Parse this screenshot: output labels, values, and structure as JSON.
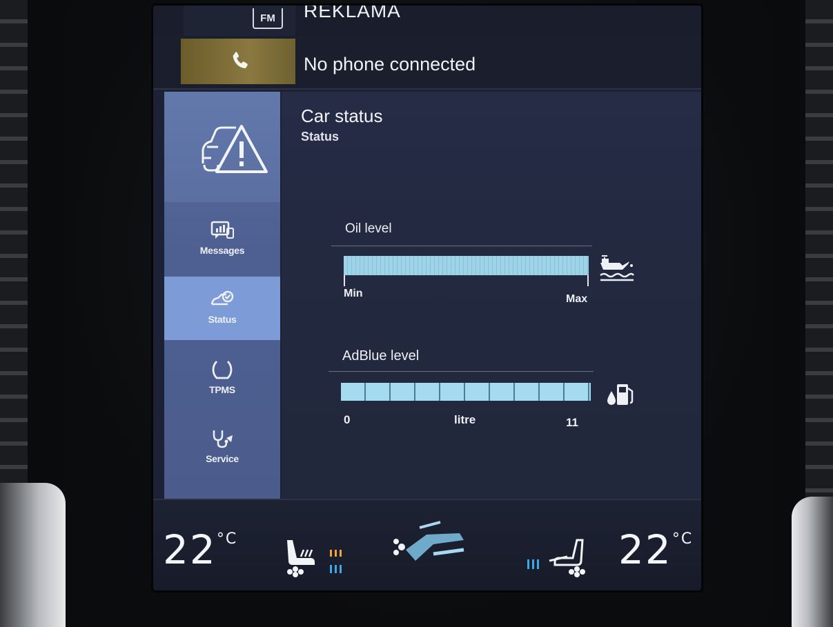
{
  "top_rows": {
    "radio": {
      "source_badge": "FM",
      "text": "REKLAMA"
    },
    "phone": {
      "icon": "phone-icon",
      "text": "No phone connected"
    }
  },
  "sidebar": {
    "header_icon": "car-warning-icon",
    "items": [
      {
        "label": "Messages",
        "icon": "messages-icon",
        "active": false
      },
      {
        "label": "Status",
        "icon": "car-status-icon",
        "active": true
      },
      {
        "label": "TPMS",
        "icon": "tire-icon",
        "active": false
      },
      {
        "label": "Service",
        "icon": "stethoscope-icon",
        "active": false
      }
    ]
  },
  "main": {
    "title": "Car status",
    "subtitle": "Status",
    "oil": {
      "label": "Oil level",
      "min_label": "Min",
      "max_label": "Max",
      "fill_fraction": 1.0,
      "icon": "oil-can-icon"
    },
    "adblue": {
      "label": "AdBlue level",
      "min_label": "0",
      "unit_label": "litre",
      "max_label": "11",
      "fill_fraction": 1.0,
      "segments": 10,
      "icon": "adblue-pump-icon"
    }
  },
  "climate": {
    "left_temp": "22",
    "right_temp": "22",
    "unit": "°C",
    "left_seat_icon": "seat-heat-fan-icon",
    "center_icon": "climate-fan-icon",
    "right_seat_icon": "seat-fan-icon",
    "colors": {
      "heat_orange": "#f4a23a",
      "cool_blue": "#3fa7e8"
    }
  }
}
